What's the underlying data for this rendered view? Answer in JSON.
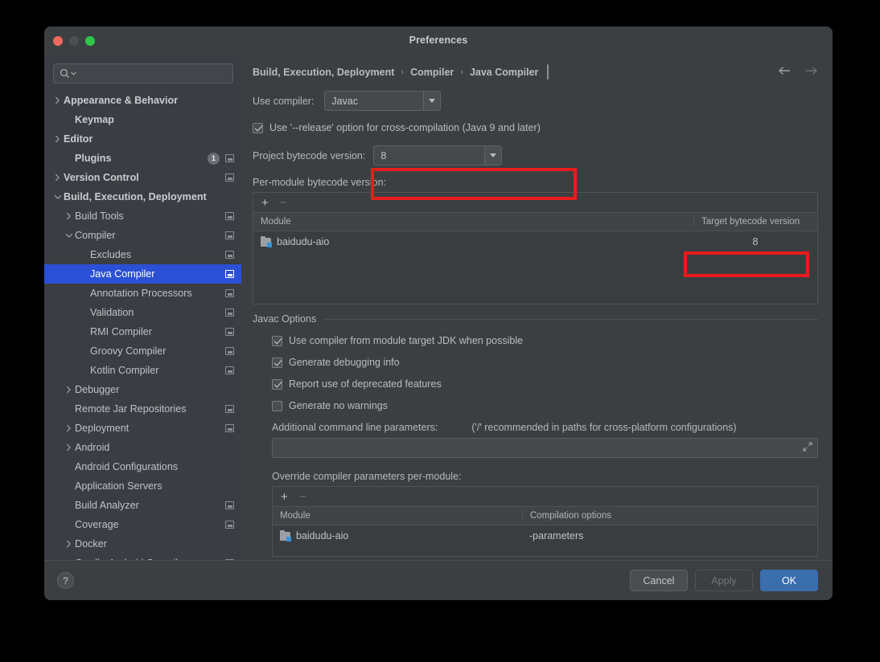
{
  "window": {
    "title": "Preferences",
    "traffic_lights": [
      "close",
      "minimize",
      "zoom"
    ]
  },
  "sidebar": {
    "search": {
      "value": "",
      "placeholder": ""
    },
    "items": [
      {
        "label": "Appearance & Behavior",
        "chevron": "right",
        "bold": true,
        "indent": 0,
        "mark": false,
        "badge": null,
        "selected": false
      },
      {
        "label": "Keymap",
        "chevron": "none",
        "bold": true,
        "indent": 1,
        "mark": false,
        "badge": null,
        "selected": false
      },
      {
        "label": "Editor",
        "chevron": "right",
        "bold": true,
        "indent": 0,
        "mark": false,
        "badge": null,
        "selected": false
      },
      {
        "label": "Plugins",
        "chevron": "none",
        "bold": true,
        "indent": 1,
        "mark": true,
        "badge": "1",
        "selected": false
      },
      {
        "label": "Version Control",
        "chevron": "right",
        "bold": true,
        "indent": 0,
        "mark": true,
        "badge": null,
        "selected": false
      },
      {
        "label": "Build, Execution, Deployment",
        "chevron": "down",
        "bold": true,
        "indent": 0,
        "mark": false,
        "badge": null,
        "selected": false
      },
      {
        "label": "Build Tools",
        "chevron": "right",
        "bold": false,
        "indent": 1,
        "mark": true,
        "badge": null,
        "selected": false
      },
      {
        "label": "Compiler",
        "chevron": "down",
        "bold": false,
        "indent": 1,
        "mark": true,
        "badge": null,
        "selected": false
      },
      {
        "label": "Excludes",
        "chevron": "none",
        "bold": false,
        "indent": 2,
        "mark": true,
        "badge": null,
        "selected": false
      },
      {
        "label": "Java Compiler",
        "chevron": "none",
        "bold": false,
        "indent": 2,
        "mark": true,
        "badge": null,
        "selected": true
      },
      {
        "label": "Annotation Processors",
        "chevron": "none",
        "bold": false,
        "indent": 2,
        "mark": true,
        "badge": null,
        "selected": false
      },
      {
        "label": "Validation",
        "chevron": "none",
        "bold": false,
        "indent": 2,
        "mark": true,
        "badge": null,
        "selected": false
      },
      {
        "label": "RMI Compiler",
        "chevron": "none",
        "bold": false,
        "indent": 2,
        "mark": true,
        "badge": null,
        "selected": false
      },
      {
        "label": "Groovy Compiler",
        "chevron": "none",
        "bold": false,
        "indent": 2,
        "mark": true,
        "badge": null,
        "selected": false
      },
      {
        "label": "Kotlin Compiler",
        "chevron": "none",
        "bold": false,
        "indent": 2,
        "mark": true,
        "badge": null,
        "selected": false
      },
      {
        "label": "Debugger",
        "chevron": "right",
        "bold": false,
        "indent": 1,
        "mark": false,
        "badge": null,
        "selected": false
      },
      {
        "label": "Remote Jar Repositories",
        "chevron": "none",
        "bold": false,
        "indent": 1,
        "mark": true,
        "badge": null,
        "selected": false
      },
      {
        "label": "Deployment",
        "chevron": "right",
        "bold": false,
        "indent": 1,
        "mark": true,
        "badge": null,
        "selected": false
      },
      {
        "label": "Android",
        "chevron": "right",
        "bold": false,
        "indent": 1,
        "mark": false,
        "badge": null,
        "selected": false
      },
      {
        "label": "Android Configurations",
        "chevron": "none",
        "bold": false,
        "indent": 1,
        "mark": false,
        "badge": null,
        "selected": false
      },
      {
        "label": "Application Servers",
        "chevron": "none",
        "bold": false,
        "indent": 1,
        "mark": false,
        "badge": null,
        "selected": false
      },
      {
        "label": "Build Analyzer",
        "chevron": "none",
        "bold": false,
        "indent": 1,
        "mark": true,
        "badge": null,
        "selected": false
      },
      {
        "label": "Coverage",
        "chevron": "none",
        "bold": false,
        "indent": 1,
        "mark": true,
        "badge": null,
        "selected": false
      },
      {
        "label": "Docker",
        "chevron": "right",
        "bold": false,
        "indent": 1,
        "mark": false,
        "badge": null,
        "selected": false
      },
      {
        "label": "Gradle-Android Compiler",
        "chevron": "none",
        "bold": false,
        "indent": 1,
        "mark": true,
        "badge": null,
        "selected": false
      }
    ]
  },
  "breadcrumb": {
    "segments": [
      "Build, Execution, Deployment",
      "Compiler",
      "Java Compiler"
    ],
    "separator": "›",
    "nav_back": "←",
    "nav_forward": "→"
  },
  "main": {
    "use_compiler": {
      "label": "Use compiler:",
      "value": "Javac"
    },
    "release_option": {
      "label": "Use '--release' option for cross-compilation (Java 9 and later)",
      "checked": true
    },
    "project_bytecode": {
      "label": "Project bytecode version:",
      "value": "8",
      "highlighted": true
    },
    "per_module": {
      "label": "Per-module bytecode version:",
      "add_button": "+",
      "remove_button": "−",
      "columns": [
        "Module",
        "Target bytecode version"
      ],
      "rows": [
        {
          "module": "baidudu-aio",
          "target": "8",
          "target_highlighted": true
        }
      ]
    },
    "javac_options": {
      "title": "Javac Options",
      "checkboxes": [
        {
          "label": "Use compiler from module target JDK when possible",
          "checked": true
        },
        {
          "label": "Generate debugging info",
          "checked": true
        },
        {
          "label": "Report use of deprecated features",
          "checked": true
        },
        {
          "label": "Generate no warnings",
          "checked": false
        }
      ],
      "additional_params": {
        "label": "Additional command line parameters:",
        "hint": "('/' recommended in paths for cross-platform configurations)",
        "value": "",
        "expand_icon": "expand-icon"
      },
      "override": {
        "label": "Override compiler parameters per-module:",
        "add_button": "+",
        "remove_button": "−",
        "columns": [
          "Module",
          "Compilation options"
        ],
        "rows": [
          {
            "module": "baidudu-aio",
            "options": "-parameters"
          }
        ]
      }
    }
  },
  "footer": {
    "help": "?",
    "cancel": "Cancel",
    "apply": "Apply",
    "ok": "OK"
  },
  "colors": {
    "selection_blue": "#2b50d6",
    "primary_button": "#3b6ead",
    "annotation_red": "#e81c1c",
    "module_badge_blue": "#3592d8"
  }
}
